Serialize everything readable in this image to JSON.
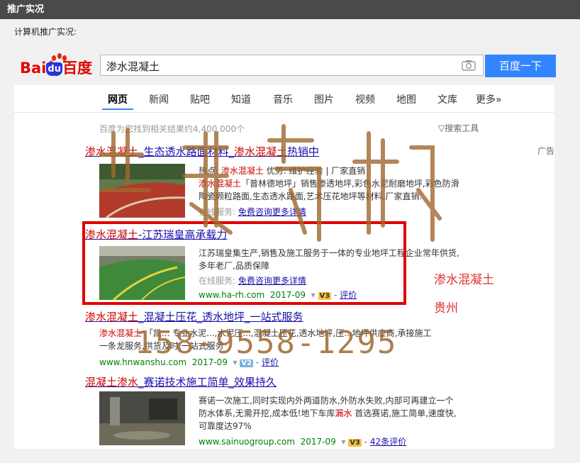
{
  "window": {
    "title": "推广实况"
  },
  "subtitle": "计算机推广实况:",
  "logo": {
    "text_left": "Bai",
    "text_du": "du",
    "text_right": "百度"
  },
  "search": {
    "query": "渗水混凝土",
    "button": "百度一下",
    "camera_icon": "camera-icon"
  },
  "tabs": [
    "网页",
    "新闻",
    "贴吧",
    "知道",
    "音乐",
    "图片",
    "视频",
    "地图",
    "文库",
    "更多»"
  ],
  "result_count": "百度为您找到相关结果约4,400,000个",
  "search_tools": "搜索工具",
  "ad_label": "广告",
  "results": [
    {
      "title_parts": [
        {
          "t": "渗水混凝土",
          "em": true
        },
        {
          "t": "_生态透水路面材料_",
          "em": false
        },
        {
          "t": "渗水混凝土",
          "em": true
        },
        {
          "t": "热销中",
          "em": false
        }
      ],
      "snippet_line1_a": "热点: ",
      "snippet_line1_em": "渗水混凝土",
      "snippet_line1_b": "  优势: 维护经验 | 厂家直销",
      "snippet_line2_em": "渗水混凝土",
      "snippet_line2_b": "「普林德地坪」销售渗透地坪,彩色水泥耐磨地坪,彩色防滑",
      "snippet_line3": "陶瓷颗粒路面,生态透水路面,艺术压花地坪等材料,厂家直销.",
      "service_label": "在线服务:",
      "service_link": "免费咨询更多详情"
    },
    {
      "title_parts": [
        {
          "t": "渗水混凝土",
          "em": true
        },
        {
          "t": "-江苏瑞皇高承载力",
          "em": false
        }
      ],
      "snippet_line1": "江苏瑞皇集生产,销售及施工服务于一体的专业地坪工程企业常年供货,",
      "snippet_line2": "多年老厂,品质保障",
      "service_label": "在线服务:",
      "service_link": "免费咨询更多详情",
      "url": "www.ha-rh.com",
      "date": "2017-09",
      "badge": "V3",
      "eval": "评价"
    },
    {
      "title_parts": [
        {
          "t": "渗水混凝土",
          "em": true
        },
        {
          "t": "_混凝土压花_透水地坪_一站式服务",
          "em": false
        }
      ],
      "snippet_line1_em": "渗水混凝土",
      "snippet_line1_b": " 「凯... 专业水泥...,水泥压...,混凝土压花,透水地坪,压...地坪供应商,承接施工",
      "snippet_line2": "一条龙服务,供货及时,一站式服务",
      "url": "www.hnwanshu.com",
      "date": "2017-09",
      "badge": "V2",
      "eval": "评价"
    },
    {
      "title_parts": [
        {
          "t": "混凝土渗水",
          "em": true
        },
        {
          "t": "_赛诺技术施工简单_效果持久",
          "em": false
        }
      ],
      "snippet_line1": "赛诺一次施工,同时实现内外两道防水,外防水失败,内部可再建立一个",
      "snippet_line2_a": "防水体系,无需开挖,成本低!地下车库",
      "snippet_line2_em": "漏水",
      "snippet_line2_b": " 首选赛诺,施工简单,速度快,",
      "snippet_line3": "可靠度达97%",
      "url": "www.sainuogroup.com",
      "date": "2017-09",
      "badge": "V3",
      "eval": "42条评价"
    }
  ],
  "annotations": {
    "keyword": "渗水混凝土",
    "region": "贵州",
    "phone": "158-9558-1295"
  },
  "colors": {
    "accent": "#3385ff",
    "highlight_box": "#e20000",
    "watermark": "#a0672e"
  }
}
